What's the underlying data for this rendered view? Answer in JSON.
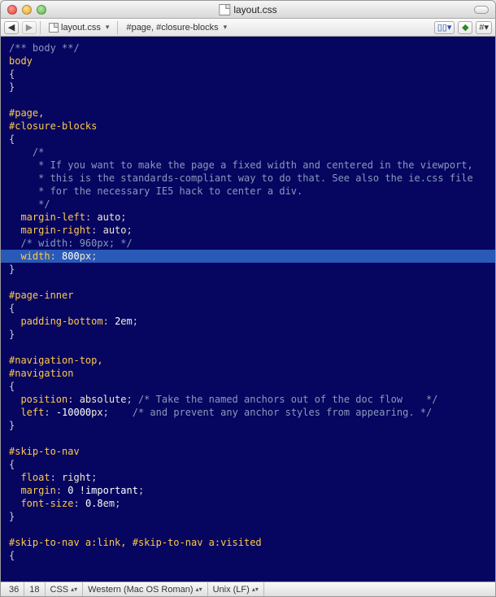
{
  "window": {
    "title": "layout.css"
  },
  "toolbar": {
    "back": "◀",
    "fwd": "▶",
    "file_crumb": "layout.css",
    "symbol_crumb": "#page, #closure-blocks",
    "hash_label": "# "
  },
  "code": {
    "lines": [
      {
        "t": "comment",
        "text": "/** body **/"
      },
      {
        "t": "sel",
        "text": "body"
      },
      {
        "t": "plain",
        "text": "{"
      },
      {
        "t": "plain",
        "text": "}"
      },
      {
        "t": "blank",
        "text": ""
      },
      {
        "t": "sel",
        "text": "#page,"
      },
      {
        "t": "sel",
        "text": "#closure-blocks"
      },
      {
        "t": "plain",
        "text": "{"
      },
      {
        "t": "comment",
        "indent": 2,
        "text": "/*"
      },
      {
        "t": "comment",
        "indent": 2,
        "text": " * If you want to make the page a fixed width and centered in the viewport,"
      },
      {
        "t": "comment",
        "indent": 2,
        "text": " * this is the standards-compliant way to do that. See also the ie.css file"
      },
      {
        "t": "comment",
        "indent": 2,
        "text": " * for the necessary IE5 hack to center a div."
      },
      {
        "t": "comment",
        "indent": 2,
        "text": " */"
      },
      {
        "t": "decl",
        "indent": 1,
        "prop": "margin-left",
        "val": "auto",
        "after": ";"
      },
      {
        "t": "decl",
        "indent": 1,
        "prop": "margin-right",
        "val": "auto",
        "after": ";"
      },
      {
        "t": "comment",
        "indent": 1,
        "text": "/* width: 960px; */"
      },
      {
        "t": "decl",
        "indent": 1,
        "prop": "width",
        "val": "800px",
        "after": ";",
        "hl": true
      },
      {
        "t": "plain",
        "text": "}"
      },
      {
        "t": "blank",
        "text": ""
      },
      {
        "t": "sel",
        "text": "#page-inner"
      },
      {
        "t": "plain",
        "text": "{"
      },
      {
        "t": "decl",
        "indent": 1,
        "prop": "padding-bottom",
        "val": "2em",
        "after": ";"
      },
      {
        "t": "plain",
        "text": "}"
      },
      {
        "t": "blank",
        "text": ""
      },
      {
        "t": "sel",
        "text": "#navigation-top,"
      },
      {
        "t": "sel",
        "text": "#navigation"
      },
      {
        "t": "plain",
        "text": "{"
      },
      {
        "t": "decl",
        "indent": 1,
        "prop": "position",
        "val": "absolute",
        "after": ";",
        "trail_comment": " /* Take the named anchors out of the doc flow    */"
      },
      {
        "t": "decl",
        "indent": 1,
        "prop": "left",
        "val": "-10000px",
        "after": ";",
        "trail_comment": "    /* and prevent any anchor styles from appearing. */"
      },
      {
        "t": "plain",
        "text": "}"
      },
      {
        "t": "blank",
        "text": ""
      },
      {
        "t": "sel",
        "text": "#skip-to-nav"
      },
      {
        "t": "plain",
        "text": "{"
      },
      {
        "t": "decl",
        "indent": 1,
        "prop": "float",
        "val": "right",
        "after": ";"
      },
      {
        "t": "decl",
        "indent": 1,
        "prop": "margin",
        "val": "0 !important",
        "after": ";"
      },
      {
        "t": "decl",
        "indent": 1,
        "prop": "font-size",
        "val": "0.8em",
        "after": ";"
      },
      {
        "t": "plain",
        "text": "}"
      },
      {
        "t": "blank",
        "text": ""
      },
      {
        "t": "sel",
        "text": "#skip-to-nav a:link, #skip-to-nav a:visited"
      },
      {
        "t": "plain",
        "text": "{"
      }
    ]
  },
  "status": {
    "line": "36",
    "col": "18",
    "lang": "CSS",
    "encoding": "Western (Mac OS Roman)",
    "line_endings": "Unix (LF)"
  }
}
